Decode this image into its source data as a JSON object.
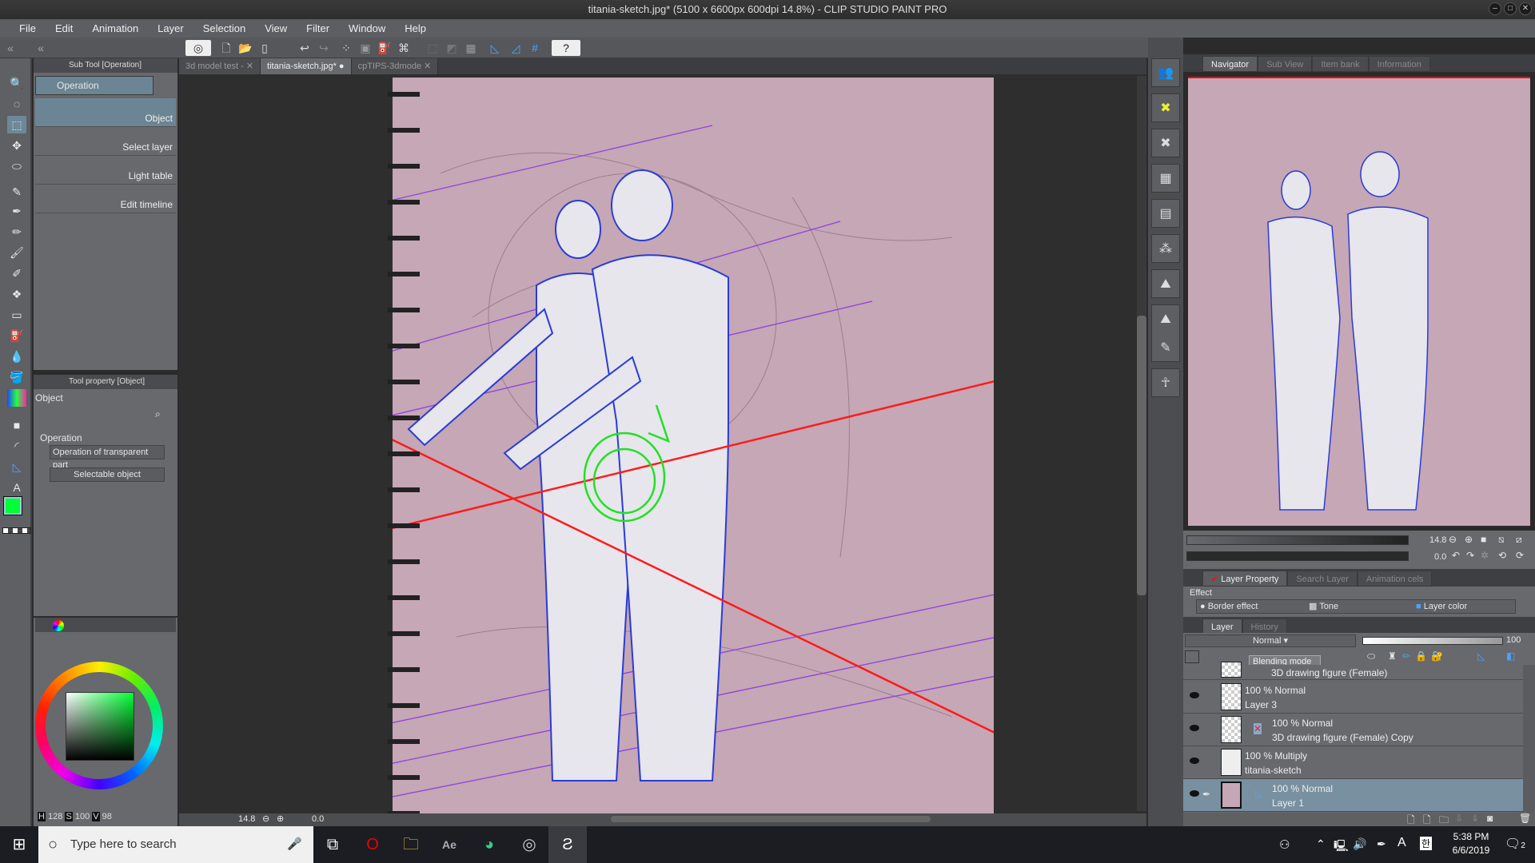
{
  "window": {
    "title": "titania-sketch.jpg* (5100 x 6600px 600dpi 14.8%)  - CLIP STUDIO PAINT PRO"
  },
  "menu": [
    "File",
    "Edit",
    "Animation",
    "Layer",
    "Selection",
    "View",
    "Filter",
    "Window",
    "Help"
  ],
  "subtool": {
    "panel_title": "Sub Tool [Operation]",
    "group": "Operation",
    "items": [
      {
        "label": "Object",
        "selected": true
      },
      {
        "label": "Select layer"
      },
      {
        "label": "Light table"
      },
      {
        "label": "Edit timeline"
      }
    ]
  },
  "tool_property": {
    "panel_title": "Tool property [Object]",
    "tool_name": "Object",
    "section": "Operation",
    "dropdown1": "Operation of transparent part",
    "dropdown2": "Selectable object"
  },
  "color": {
    "main": "#00ff33",
    "sub": "#c5a7b5",
    "h_label": "H",
    "h": "128",
    "s_label": "S",
    "s": "100",
    "v_label": "V",
    "v": "98"
  },
  "doc_tabs": [
    {
      "label": "3d model test -",
      "active": false
    },
    {
      "label": "titania-sketch.jpg*",
      "active": true
    },
    {
      "label": "cpTIPS-3dmode",
      "active": false
    }
  ],
  "canvas_status": {
    "zoom": "14.8",
    "angle": "0.0"
  },
  "navigator": {
    "tabs": [
      "Navigator",
      "Sub View",
      "Item bank",
      "Information"
    ],
    "zoom": "14.8",
    "angle": "0.0"
  },
  "layer_property": {
    "tabs": [
      "Layer Property",
      "Search Layer",
      "Animation cels"
    ],
    "effect_label": "Effect",
    "effects": [
      "Border effect",
      "Tone",
      "Layer color"
    ]
  },
  "layers_panel": {
    "tabs": [
      "Layer",
      "History"
    ],
    "blend_mode": "Normal",
    "opacity": "100",
    "tooltip": "Blending mode",
    "layers": [
      {
        "line1": "",
        "line2": "3D drawing figure (Female)"
      },
      {
        "line1": "100 % Normal",
        "line2": "Layer 3"
      },
      {
        "line1": "100 % Normal",
        "line2": "3D drawing figure (Female) Copy"
      },
      {
        "line1": "100 % Multiply",
        "line2": "titania-sketch"
      },
      {
        "line1": "100 % Normal",
        "line2": "Layer 1",
        "selected": true
      }
    ]
  },
  "taskbar": {
    "search_placeholder": "Type here to search",
    "time": "5:38 PM",
    "date": "6/6/2019",
    "notifications": "2"
  }
}
